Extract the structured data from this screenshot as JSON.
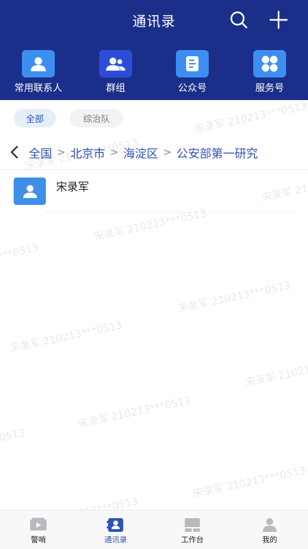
{
  "header": {
    "title": "通讯录",
    "search_icon": "search-icon",
    "add_icon": "plus-icon"
  },
  "quick_access": [
    {
      "label": "常用联系人",
      "icon": "person-icon"
    },
    {
      "label": "群组",
      "icon": "group-icon"
    },
    {
      "label": "公众号",
      "icon": "document-icon"
    },
    {
      "label": "服务号",
      "icon": "grid-icon"
    }
  ],
  "filter_tabs": [
    {
      "label": "全部",
      "active": true
    },
    {
      "label": "综治队",
      "active": false
    }
  ],
  "breadcrumb": [
    "全国",
    "北京市",
    "海淀区",
    "公安部第一研究"
  ],
  "contacts": [
    {
      "name": "宋录军"
    }
  ],
  "watermark_text": "宋录军 210213***0513",
  "bottom_nav": [
    {
      "label": "警哨",
      "icon": "video-icon",
      "active": false
    },
    {
      "label": "通讯录",
      "icon": "contacts-icon",
      "active": true
    },
    {
      "label": "工作台",
      "icon": "workbench-icon",
      "active": false
    },
    {
      "label": "我的",
      "icon": "profile-icon",
      "active": false
    }
  ],
  "colors": {
    "header_bg": "#1b2f8a",
    "accent": "#2d53b5",
    "tile_light": "#3c8ff0",
    "tile_dark": "#2c4ed6"
  }
}
